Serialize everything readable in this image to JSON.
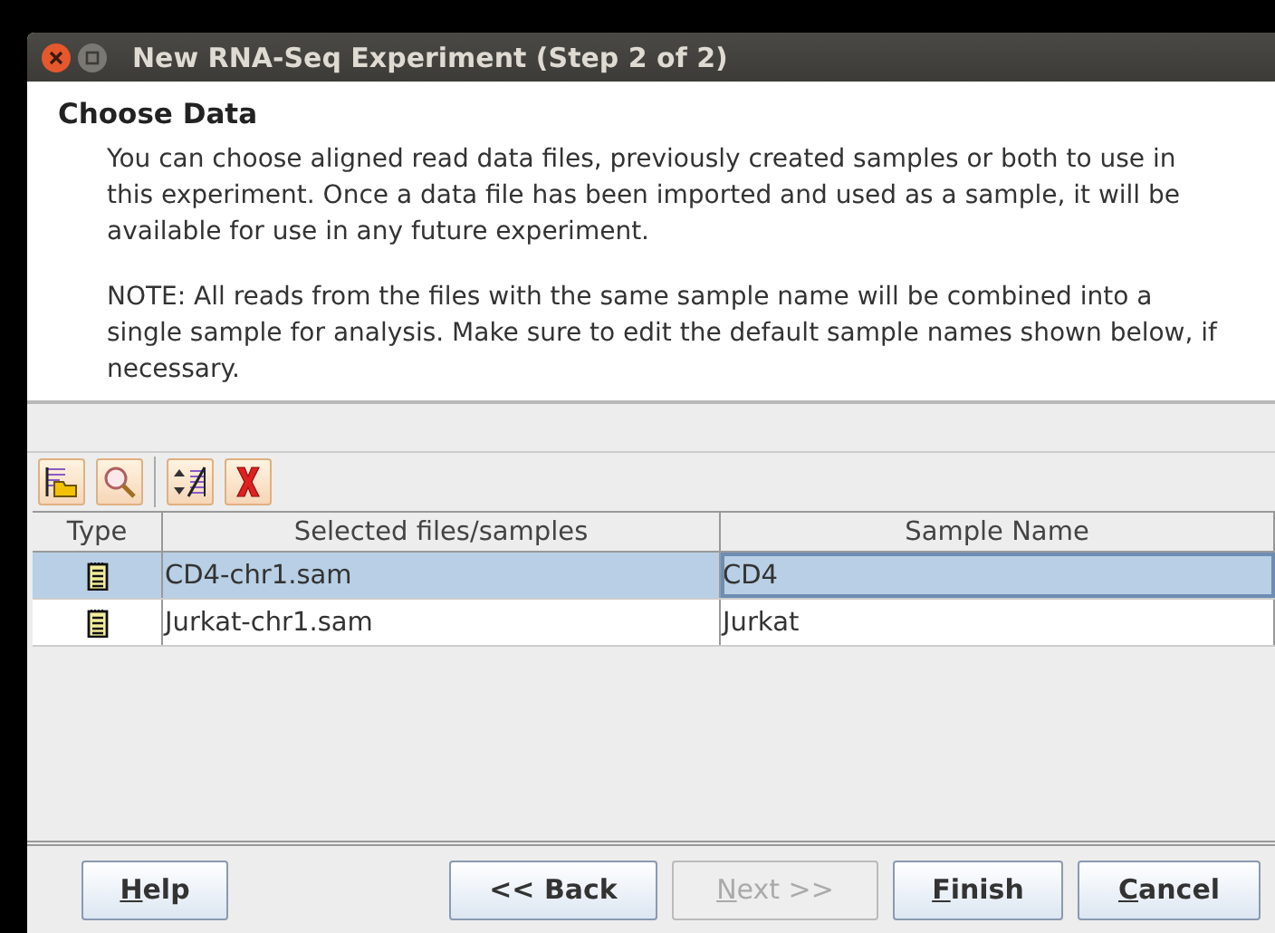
{
  "window": {
    "title": "New RNA-Seq Experiment (Step 2 of 2)"
  },
  "header": {
    "title": "Choose Data",
    "paragraphs": [
      "You can choose aligned read data files, previously created samples or both to use in this experiment. Once a data file has been imported and used as a sample, it will be available for use in any future experiment.",
      "NOTE: All reads from the files with the same sample name will be combined into a single sample for analysis. Make sure to edit the default sample names shown below, if necessary."
    ]
  },
  "toolbar": [
    {
      "kind": "add-files"
    },
    {
      "kind": "browse"
    },
    {
      "kind": "sort"
    },
    {
      "kind": "remove"
    }
  ],
  "table": {
    "columns": [
      "Type",
      "Selected files/samples",
      "Sample Name"
    ],
    "rows": [
      {
        "file": "CD4-chr1.sam",
        "sample": "CD4",
        "selected": true
      },
      {
        "file": "Jurkat-chr1.sam",
        "sample": "Jurkat",
        "selected": false
      }
    ]
  },
  "left_buttons": [
    {
      "label": "Help",
      "mnemonic": true,
      "disabled": false
    }
  ],
  "right_buttons": [
    {
      "label": "<< Back",
      "mnemonic": false,
      "disabled": false
    },
    {
      "label": "Next >>",
      "mnemonic": true,
      "disabled": true
    },
    {
      "label": "Finish",
      "mnemonic": true,
      "disabled": false
    },
    {
      "label": "Cancel",
      "mnemonic": true,
      "disabled": false
    }
  ]
}
